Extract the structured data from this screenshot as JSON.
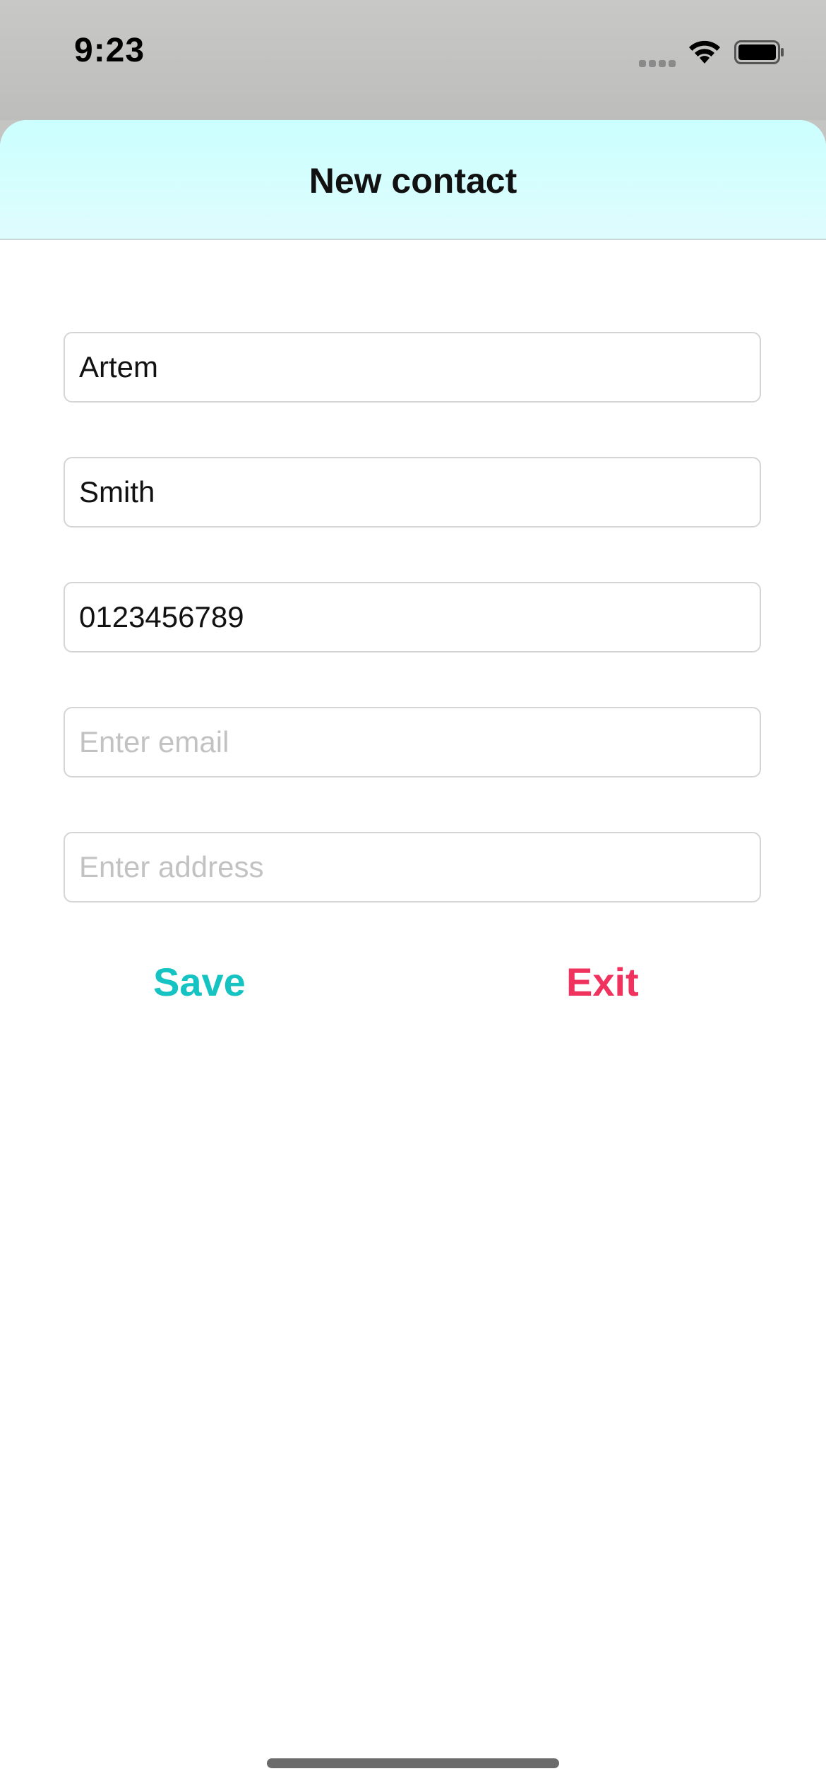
{
  "status_bar": {
    "time": "9:23",
    "icons": [
      "cellular-signal-icon",
      "wifi-icon",
      "battery-icon"
    ]
  },
  "sheet": {
    "title": "New contact"
  },
  "form": {
    "first_name": {
      "value": "Artem",
      "placeholder": ""
    },
    "last_name": {
      "value": "Smith",
      "placeholder": ""
    },
    "phone": {
      "value": "0123456789",
      "placeholder": ""
    },
    "email": {
      "value": "",
      "placeholder": "Enter email"
    },
    "address": {
      "value": "",
      "placeholder": "Enter address"
    }
  },
  "actions": {
    "save_label": "Save",
    "exit_label": "Exit"
  },
  "colors": {
    "header_background": "#cbfffe",
    "save": "#14c3c2",
    "exit": "#f0335e",
    "caret": "#3478f6"
  }
}
